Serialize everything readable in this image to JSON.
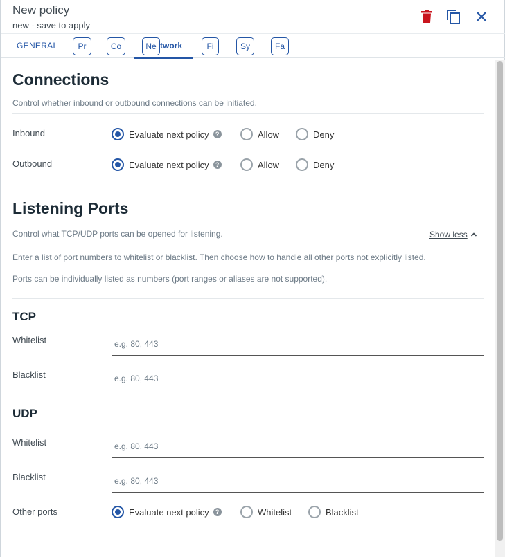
{
  "header": {
    "title": "New policy",
    "subtitle": "new - save to apply",
    "colors": {
      "delete": "#c9151e",
      "icon": "#2456a6"
    },
    "icons": [
      "trash-icon",
      "copy-icon",
      "close-icon"
    ]
  },
  "tabs": {
    "general": "GENERAL",
    "items": [
      "Pr",
      "Co",
      "Ne",
      "Fi",
      "Sy",
      "Fa"
    ],
    "active_suffix": "twork"
  },
  "connections": {
    "title": "Connections",
    "description": "Control whether inbound or outbound connections can be initiated.",
    "inbound": {
      "label": "Inbound",
      "options": [
        "Evaluate next policy",
        "Allow",
        "Deny"
      ],
      "selected": "Evaluate next policy"
    },
    "outbound": {
      "label": "Outbound",
      "options": [
        "Evaluate next policy",
        "Allow",
        "Deny"
      ],
      "selected": "Evaluate next policy"
    }
  },
  "listening": {
    "title": "Listening Ports",
    "description": "Control what TCP/UDP ports can be opened for listening.",
    "show_less": "Show less",
    "info1": "Enter a list of port numbers to whitelist or blacklist. Then choose how to handle all other ports not explicitly listed.",
    "info2": "Ports can be individually listed as numbers (port ranges or aliases are not supported).",
    "tcp": {
      "title": "TCP",
      "whitelist": {
        "label": "Whitelist",
        "value": "",
        "placeholder": "e.g. 80, 443"
      },
      "blacklist": {
        "label": "Blacklist",
        "value": "",
        "placeholder": "e.g. 80, 443"
      }
    },
    "udp": {
      "title": "UDP",
      "whitelist": {
        "label": "Whitelist",
        "value": "",
        "placeholder": "e.g. 80, 443"
      },
      "blacklist": {
        "label": "Blacklist",
        "value": "",
        "placeholder": "e.g. 80, 443"
      }
    },
    "other_ports": {
      "label": "Other ports",
      "options": [
        "Evaluate next policy",
        "Whitelist",
        "Blacklist"
      ],
      "selected": "Evaluate next policy"
    }
  },
  "accent_color": "#2456a6"
}
